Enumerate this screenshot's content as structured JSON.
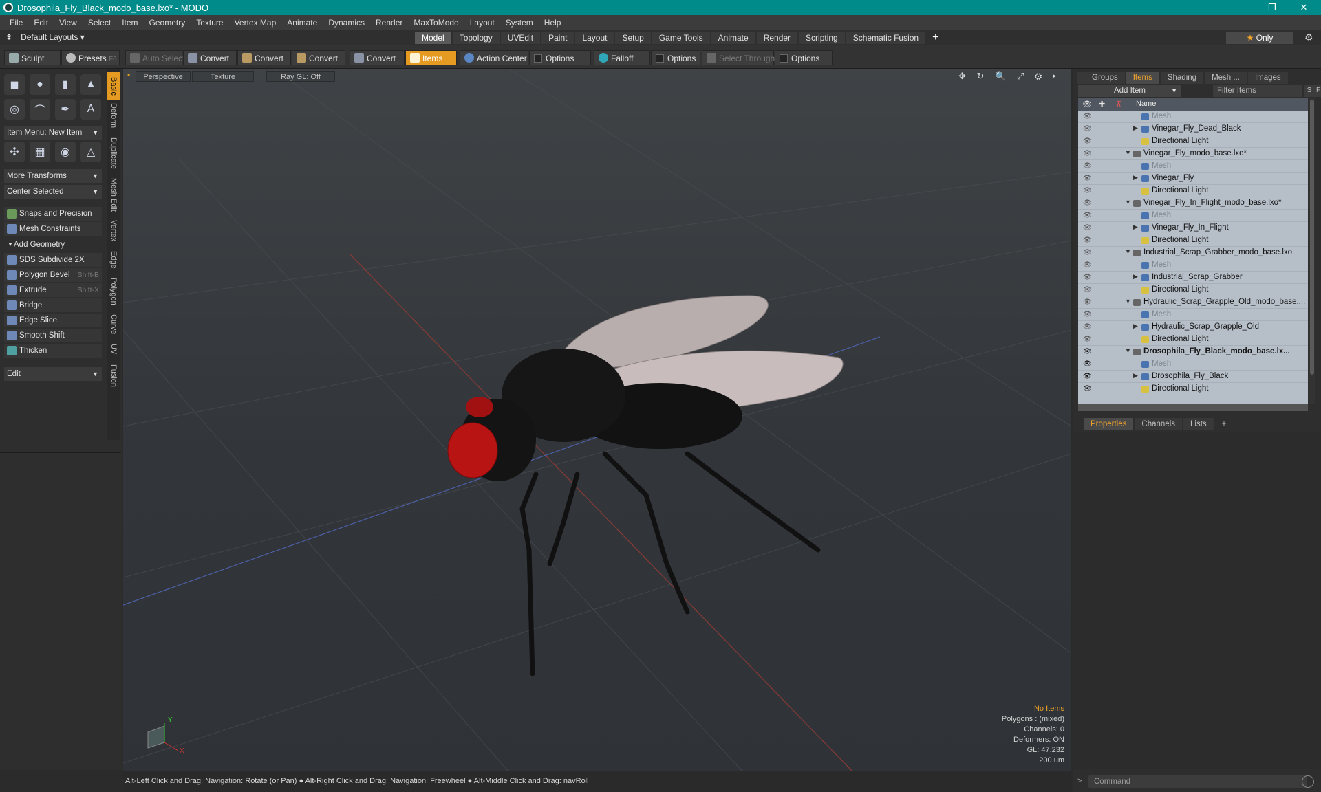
{
  "window": {
    "title": "Drosophila_Fly_Black_modo_base.lxo* - MODO",
    "minimize": "—",
    "maximize": "❐",
    "close": "✕"
  },
  "menu": [
    "File",
    "Edit",
    "View",
    "Select",
    "Item",
    "Geometry",
    "Texture",
    "Vertex Map",
    "Animate",
    "Dynamics",
    "Render",
    "MaxToModo",
    "Layout",
    "System",
    "Help"
  ],
  "layouts": {
    "label": "Default Layouts ▾"
  },
  "tabs": [
    "Model",
    "Topology",
    "UVEdit",
    "Paint",
    "Layout",
    "Setup",
    "Game Tools",
    "Animate",
    "Render",
    "Scripting",
    "Schematic Fusion"
  ],
  "tabs_plus": "+",
  "only": {
    "star": "★",
    "label": "Only"
  },
  "toolbar": {
    "sculpt": "Sculpt",
    "presets": "Presets",
    "presets_key": "F6",
    "auto_select": "Auto Select",
    "convert": "Convert",
    "items": "Items",
    "action_center": "Action Center",
    "options": "Options",
    "falloff": "Falloff",
    "select_through": "Select Through"
  },
  "vertical_tabs": [
    "Basic",
    "Deform",
    "Duplicate",
    "Mesh Edit",
    "Vertex",
    "Edge",
    "Polygon",
    "Curve",
    "UV",
    "Fusion"
  ],
  "left": {
    "item_menu": "Item Menu: New Item",
    "more_transforms": "More Transforms",
    "center_selected": "Center Selected",
    "snaps": "Snaps and Precision",
    "mesh_constraints": "Mesh Constraints",
    "add_geometry": "Add Geometry",
    "edit": "Edit"
  },
  "tools": [
    {
      "label": "SDS Subdivide 2X",
      "shortcut": ""
    },
    {
      "label": "Polygon Bevel",
      "shortcut": "Shift-B"
    },
    {
      "label": "Extrude",
      "shortcut": "Shift-X"
    },
    {
      "label": "Bridge",
      "shortcut": ""
    },
    {
      "label": "Edge Slice",
      "shortcut": ""
    },
    {
      "label": "Smooth Shift",
      "shortcut": ""
    },
    {
      "label": "Thicken",
      "shortcut": ""
    }
  ],
  "viewport": {
    "perspective": "Perspective",
    "texture": "Texture",
    "raygl": "Ray GL: Off",
    "nav_icons": "✥ ↻ 🔍 ⤢ ⚙ ▸"
  },
  "hud": {
    "no_items": "No Items",
    "polygons": "Polygons : (mixed)",
    "channels": "Channels: 0",
    "deformers": "Deformers: ON",
    "gl": "GL: 47,232",
    "scale": "200 um"
  },
  "axis": {
    "y": "Y",
    "x": "X"
  },
  "status": "Alt-Left Click and Drag: Navigation: Rotate (or Pan) ● Alt-Right Click and Drag: Navigation: Freewheel ● Alt-Middle Click and Drag: navRoll",
  "right_tabs": [
    "Groups",
    "Items",
    "Shading",
    "Mesh ...",
    "Images"
  ],
  "add_item": "Add Item",
  "filter_items": "Filter Items",
  "sf": [
    "S",
    "F"
  ],
  "list_header": "Name",
  "items": [
    {
      "label": "Mesh",
      "type": "mesh",
      "indent": 2,
      "eye": false
    },
    {
      "label": "Vinegar_Fly_Dead_Black",
      "type": "mesh",
      "indent": 2,
      "eye": false,
      "tri": "▶"
    },
    {
      "label": "Directional Light",
      "type": "light",
      "indent": 2,
      "eye": false
    },
    {
      "label": "Vinegar_Fly_modo_base.lxo*",
      "type": "scene",
      "indent": 1,
      "eye": false,
      "tri": "▼"
    },
    {
      "label": "Mesh",
      "type": "mesh",
      "indent": 2,
      "eye": false
    },
    {
      "label": "Vinegar_Fly",
      "type": "mesh",
      "indent": 2,
      "eye": false,
      "tri": "▶"
    },
    {
      "label": "Directional Light",
      "type": "light",
      "indent": 2,
      "eye": false
    },
    {
      "label": "Vinegar_Fly_In_Flight_modo_base.lxo*",
      "type": "scene",
      "indent": 1,
      "eye": false,
      "tri": "▼"
    },
    {
      "label": "Mesh",
      "type": "mesh",
      "indent": 2,
      "eye": false
    },
    {
      "label": "Vinegar_Fly_In_Flight",
      "type": "mesh",
      "indent": 2,
      "eye": false,
      "tri": "▶"
    },
    {
      "label": "Directional Light",
      "type": "light",
      "indent": 2,
      "eye": false
    },
    {
      "label": "Industrial_Scrap_Grabber_modo_base.lxo",
      "type": "scene",
      "indent": 1,
      "eye": false,
      "tri": "▼"
    },
    {
      "label": "Mesh",
      "type": "mesh",
      "indent": 2,
      "eye": false
    },
    {
      "label": "Industrial_Scrap_Grabber",
      "type": "mesh",
      "indent": 2,
      "eye": false,
      "tri": "▶"
    },
    {
      "label": "Directional Light",
      "type": "light",
      "indent": 2,
      "eye": false
    },
    {
      "label": "Hydraulic_Scrap_Grapple_Old_modo_base....",
      "type": "scene",
      "indent": 1,
      "eye": false,
      "tri": "▼"
    },
    {
      "label": "Mesh",
      "type": "mesh",
      "indent": 2,
      "eye": false
    },
    {
      "label": "Hydraulic_Scrap_Grapple_Old",
      "type": "mesh",
      "indent": 2,
      "eye": false,
      "tri": "▶"
    },
    {
      "label": "Directional Light",
      "type": "light",
      "indent": 2,
      "eye": false
    },
    {
      "label": "Drosophila_Fly_Black_modo_base.lx...",
      "type": "scene",
      "indent": 1,
      "eye": true,
      "tri": "▼",
      "bold": true
    },
    {
      "label": "Mesh",
      "type": "mesh",
      "indent": 2,
      "eye": true
    },
    {
      "label": "Drosophila_Fly_Black",
      "type": "mesh",
      "indent": 2,
      "eye": true,
      "tri": "▶"
    },
    {
      "label": "Directional Light",
      "type": "light",
      "indent": 2,
      "eye": true
    }
  ],
  "prop_tabs": [
    "Properties",
    "Channels",
    "Lists"
  ],
  "prop_plus": "+",
  "command": "Command",
  "colors": {
    "accent": "#e59a21",
    "title": "#008b8b",
    "list_bg": "#b6bec8"
  }
}
